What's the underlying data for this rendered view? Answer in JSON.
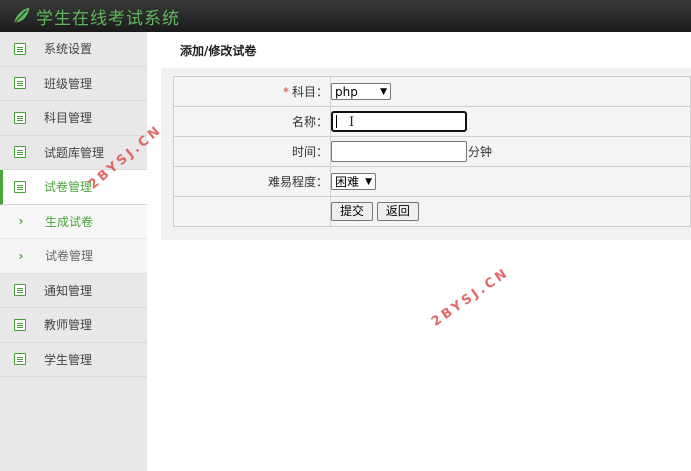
{
  "app": {
    "title": "学生在线考试系统"
  },
  "sidebar": {
    "items": [
      {
        "label": "系统设置"
      },
      {
        "label": "班级管理"
      },
      {
        "label": "科目管理"
      },
      {
        "label": "试题库管理"
      },
      {
        "label": "试卷管理"
      },
      {
        "label": "生成试卷"
      },
      {
        "label": "试卷管理"
      },
      {
        "label": "通知管理"
      },
      {
        "label": "教师管理"
      },
      {
        "label": "学生管理"
      }
    ]
  },
  "main": {
    "title": "添加/修改试卷",
    "form": {
      "subject_label": "科目：",
      "subject_value": "php",
      "name_label": "名称：",
      "name_value": "",
      "time_label": "时间：",
      "time_value": "",
      "time_unit": "分钟",
      "difficulty_label": "难易程度：",
      "difficulty_value": "困难",
      "submit_label": "提交",
      "back_label": "返回"
    }
  },
  "watermark": {
    "text": "2BYSJ.CN"
  },
  "colors": {
    "accent": "#4aa63b",
    "header_bg": "#2a2a2a",
    "required": "#e4393c"
  }
}
